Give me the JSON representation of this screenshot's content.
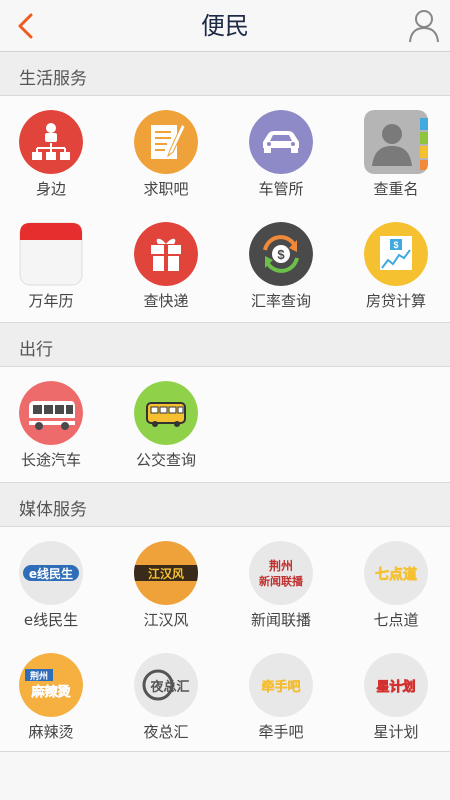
{
  "header": {
    "title": "便民"
  },
  "sections": [
    {
      "title": "生活服务",
      "items": [
        {
          "label": "身边",
          "icon": "org-chart-icon",
          "color": "#e0443a"
        },
        {
          "label": "求职吧",
          "icon": "resume-icon",
          "color": "#f0a23a"
        },
        {
          "label": "车管所",
          "icon": "car-icon",
          "color": "#8d8ac7"
        },
        {
          "label": "查重名",
          "icon": "contacts-icon",
          "color": "#9a9a9a"
        },
        {
          "label": "万年历",
          "icon": "calendar-icon",
          "color": "#e0443a"
        },
        {
          "label": "查快递",
          "icon": "gift-icon",
          "color": "#e0443a"
        },
        {
          "label": "汇率查询",
          "icon": "exchange-icon",
          "color": "#4a4a4a"
        },
        {
          "label": "房贷计算",
          "icon": "loan-chart-icon",
          "color": "#f5c130"
        }
      ]
    },
    {
      "title": "出行",
      "items": [
        {
          "label": "长途汽车",
          "icon": "coach-icon",
          "color": "#ee6b6b"
        },
        {
          "label": "公交查询",
          "icon": "bus-icon",
          "color": "#8fd24a"
        }
      ]
    },
    {
      "title": "媒体服务",
      "items": [
        {
          "label": "e线民生",
          "icon": "e-xian-minsheng-logo",
          "color": "#2f6db8"
        },
        {
          "label": "江汉风",
          "icon": "jianghanfeng-logo",
          "color": "#f0a23a"
        },
        {
          "label": "新闻联播",
          "icon": "news-logo",
          "color": "#c0302f"
        },
        {
          "label": "七点道",
          "icon": "qidiandao-logo",
          "color": "#c0302f"
        },
        {
          "label": "麻辣烫",
          "icon": "malatang-logo",
          "color": "#2f6db8"
        },
        {
          "label": "夜总汇",
          "icon": "yezonghui-logo",
          "color": "#555555"
        },
        {
          "label": "牵手吧",
          "icon": "qianshouba-logo",
          "color": "#c0308e"
        },
        {
          "label": "星计划",
          "icon": "xingjihua-logo",
          "color": "#d4302f"
        }
      ]
    }
  ],
  "logos": {
    "exian": "e线民生",
    "jhf": "江汉风",
    "news1": "荆州",
    "news2": "新闻联播",
    "qdd": "七点道",
    "mlt1": "荆州",
    "mlt2": "麻辣烫",
    "yzh": "夜总汇",
    "qsb": "牵手吧",
    "xjh": "星计划"
  },
  "colors": {
    "accent": "#f05a1e",
    "title": "#1e2a44"
  }
}
